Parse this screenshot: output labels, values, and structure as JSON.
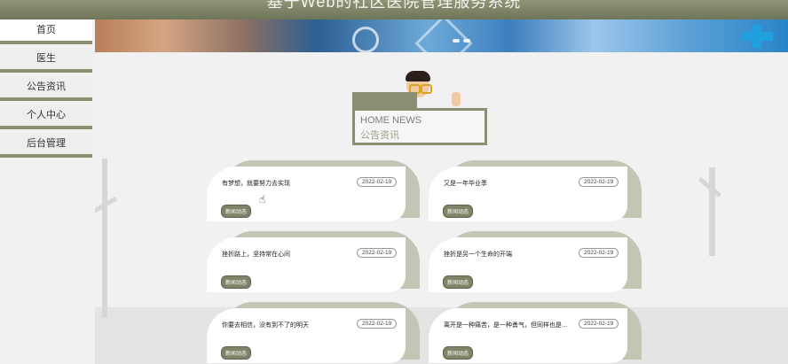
{
  "header": {
    "title": "基于Web的社区医院管理服务系统"
  },
  "sidebar": {
    "items": [
      {
        "label": "首页",
        "active": true
      },
      {
        "label": "医生"
      },
      {
        "label": "公告资讯"
      },
      {
        "label": "个人中心"
      },
      {
        "label": "后台管理"
      }
    ]
  },
  "section": {
    "title_en": "HOME NEWS",
    "title_cn": "公告资讯"
  },
  "news": [
    {
      "title": "有梦想，就要努力去实现",
      "date": "2022-02-19",
      "tag": "新闻动态"
    },
    {
      "title": "又是一年毕业季",
      "date": "2022-02-19",
      "tag": "新闻动态"
    },
    {
      "title": "挫折路上，坚持常在心间",
      "date": "2022-02-19",
      "tag": "新闻动态"
    },
    {
      "title": "挫折是另一个生命的开端",
      "date": "2022-02-19",
      "tag": "新闻动态"
    },
    {
      "title": "你要去相信，没有到不了的明天",
      "date": "2022-02-19",
      "tag": "新闻动态"
    },
    {
      "title": "离开是一种痛苦，是一种勇气，但同样也是一...",
      "date": "2022-02-19",
      "tag": "新闻动态"
    }
  ],
  "colors": {
    "accent": "#8a8f72",
    "card_back": "#c3c5b5",
    "tag_bg": "#7f8468"
  },
  "icons": {
    "cursor": "hand-pointer-icon",
    "banner_cross": "medical-cross-icon"
  }
}
